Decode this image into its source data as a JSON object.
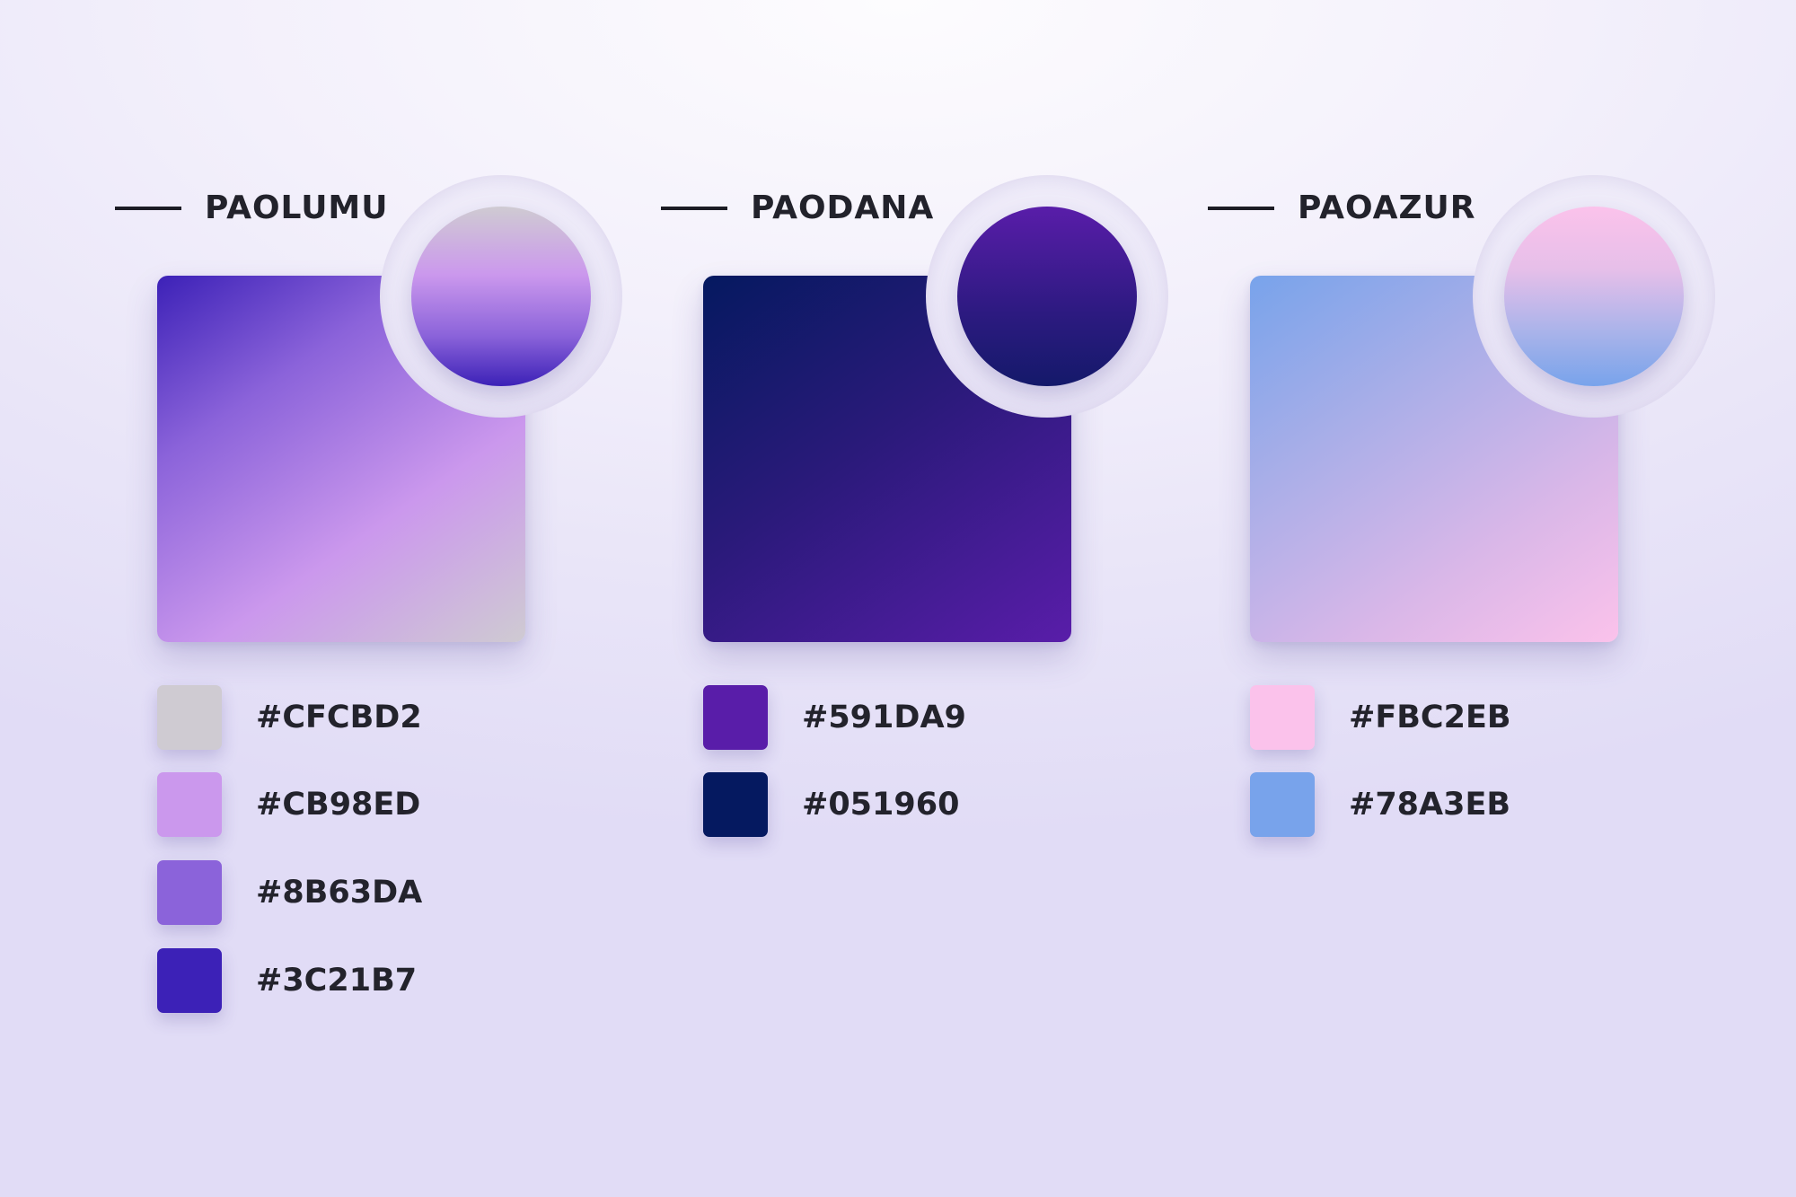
{
  "palettes": [
    {
      "name": "PAOLUMU",
      "colors": [
        {
          "hex": "#CFCBD2"
        },
        {
          "hex": "#CB98ED"
        },
        {
          "hex": "#8B63DA"
        },
        {
          "hex": "#3C21B7"
        }
      ]
    },
    {
      "name": "PAODANA",
      "colors": [
        {
          "hex": "#591DA9"
        },
        {
          "hex": "#051960"
        }
      ]
    },
    {
      "name": "PAOAZUR",
      "colors": [
        {
          "hex": "#FBC2EB"
        },
        {
          "hex": "#78A3EB"
        }
      ]
    }
  ]
}
